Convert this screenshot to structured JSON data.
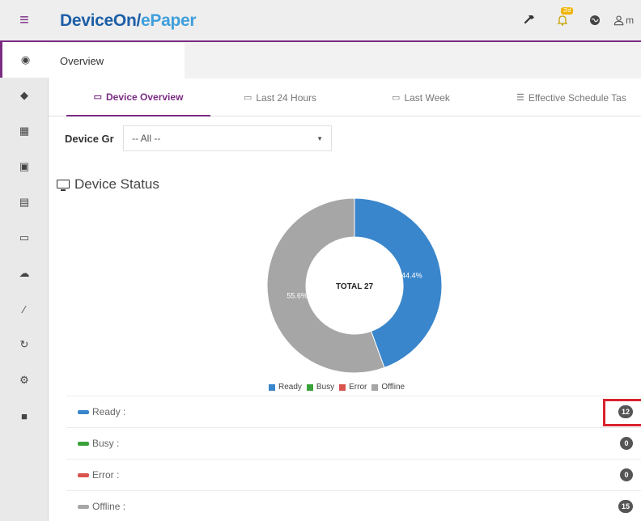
{
  "app": {
    "brand_main": "DeviceOn/",
    "brand_accent": "ePaper",
    "notification_badge": "2ld",
    "user_text": "m"
  },
  "page_tab": {
    "label": "Overview"
  },
  "tabs": [
    {
      "label": "Device Overview",
      "active": true
    },
    {
      "label": "Last 24 Hours"
    },
    {
      "label": "Last Week"
    },
    {
      "label": "Effective Schedule Tas"
    }
  ],
  "filter": {
    "label": "Device Gr",
    "value": "-- All --"
  },
  "section": {
    "title": "Device Status"
  },
  "chart_data": {
    "type": "pie",
    "total_label": "TOTAL 27",
    "slices": [
      {
        "name": "Ready",
        "value": 12,
        "label": "44.4%",
        "color": "#3a86cc"
      },
      {
        "name": "Busy",
        "value": 0,
        "color": "#3aa23a"
      },
      {
        "name": "Error",
        "value": 0,
        "color": "#d9534f"
      },
      {
        "name": "Offline",
        "value": 15,
        "label": "55.6%",
        "color": "#a6a6a6"
      }
    ],
    "legend": [
      "Ready",
      "Busy",
      "Error",
      "Offline"
    ],
    "legend_position": "bottom"
  },
  "status_rows": [
    {
      "label": "Ready :",
      "count": "12",
      "color": "#3a86cc"
    },
    {
      "label": "Busy :",
      "count": "0",
      "color": "#3aa23a"
    },
    {
      "label": "Error :",
      "count": "0",
      "color": "#d9534f"
    },
    {
      "label": "Offline :",
      "count": "15",
      "color": "#a6a6a6"
    }
  ],
  "colors": {
    "accent": "#7b2c83",
    "brand": "#1d5fa8",
    "highlight": "#d9232d"
  }
}
